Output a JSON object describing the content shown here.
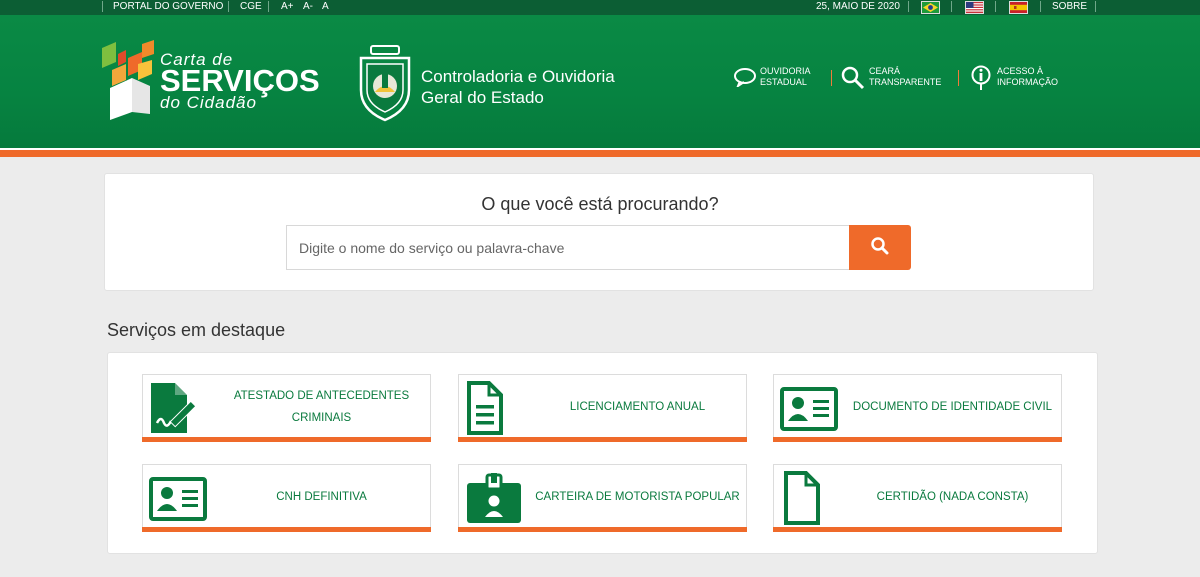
{
  "topbar": {
    "portal": "PORTAL DO GOVERNO",
    "cge": "CGE",
    "font_increase": "A+",
    "font_decrease": "A-",
    "font_default": "A",
    "date": "25, MAIO DE 2020",
    "about": "SOBRE",
    "languages": [
      "pt-BR flag",
      "en-US flag",
      "es flag"
    ]
  },
  "logo": {
    "line1": "Carta de",
    "line2": "SERVIÇOS",
    "line3": "do Cidadão"
  },
  "org": {
    "line1": "Controladoria e Ouvidoria",
    "line2": "Geral do Estado"
  },
  "header_links": [
    {
      "line1": "OUVIDORIA",
      "line2": "ESTADUAL",
      "icon": "speech-bubble-icon"
    },
    {
      "line1": "CEARÁ",
      "line2": "TRANSPARENTE",
      "icon": "magnifier-icon"
    },
    {
      "line1": "ACESSO À",
      "line2": "INFORMAÇÃO",
      "icon": "info-icon"
    }
  ],
  "search": {
    "question": "O que você está procurando?",
    "placeholder": "Digite o nome do serviço ou palavra-chave",
    "value": ""
  },
  "featured": {
    "title": "Serviços em destaque",
    "cards": [
      {
        "label": "ATESTADO DE ANTECEDENTES CRIMINAIS",
        "icon": "signed-document-icon"
      },
      {
        "label": "LICENCIAMENTO ANUAL",
        "icon": "document-icon"
      },
      {
        "label": "DOCUMENTO DE IDENTIDADE CIVIL",
        "icon": "id-card-icon"
      },
      {
        "label": "CNH DEFINITIVA",
        "icon": "id-card-icon"
      },
      {
        "label": "CARTEIRA DE MOTORISTA POPULAR",
        "icon": "badge-icon"
      },
      {
        "label": "CERTIDÃO (NADA CONSTA)",
        "icon": "blank-document-icon"
      }
    ]
  },
  "colors": {
    "green": "#068341",
    "dark_green": "#0c5e34",
    "orange": "#ef6a2a",
    "icon_green": "#0a7a3e"
  }
}
